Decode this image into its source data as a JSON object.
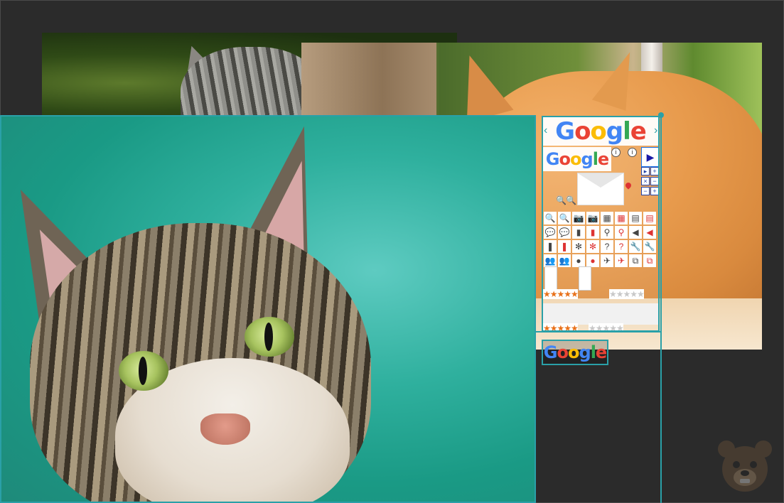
{
  "logo": {
    "letters": [
      "G",
      "o",
      "o",
      "g",
      "l",
      "e"
    ]
  },
  "sprite": {
    "chevron_left": "‹",
    "chevron_right": "›",
    "info_glyph": "i",
    "play_glyph": "▶",
    "tiny_buttons": [
      "▸",
      "+",
      "×",
      "−",
      "−",
      "+"
    ],
    "magnifier_glyphs": [
      "🔍",
      "🔍"
    ],
    "icon_grid": [
      {
        "glyph": "🔍",
        "red": false
      },
      {
        "glyph": "🔍",
        "red": true
      },
      {
        "glyph": "📷",
        "red": false
      },
      {
        "glyph": "📷",
        "red": true
      },
      {
        "glyph": "▦",
        "red": false
      },
      {
        "glyph": "▦",
        "red": true
      },
      {
        "glyph": "▤",
        "red": false
      },
      {
        "glyph": "▤",
        "red": true
      },
      {
        "glyph": "💬",
        "red": false
      },
      {
        "glyph": "💬",
        "red": true
      },
      {
        "glyph": "▮",
        "red": false
      },
      {
        "glyph": "▮",
        "red": true
      },
      {
        "glyph": "⚲",
        "red": false
      },
      {
        "glyph": "⚲",
        "red": true
      },
      {
        "glyph": "◀",
        "red": false
      },
      {
        "glyph": "◀",
        "red": true
      },
      {
        "glyph": "❚",
        "red": false
      },
      {
        "glyph": "❚",
        "red": true
      },
      {
        "glyph": "✻",
        "red": false
      },
      {
        "glyph": "✻",
        "red": true
      },
      {
        "glyph": "?",
        "red": false
      },
      {
        "glyph": "?",
        "red": true
      },
      {
        "glyph": "🔧",
        "red": false
      },
      {
        "glyph": "🔧",
        "red": true
      },
      {
        "glyph": "👥",
        "red": false
      },
      {
        "glyph": "👥",
        "red": true
      },
      {
        "glyph": "●",
        "red": false
      },
      {
        "glyph": "●",
        "red": true
      },
      {
        "glyph": "✈",
        "red": false
      },
      {
        "glyph": "✈",
        "red": true
      },
      {
        "glyph": "⧉",
        "red": false
      },
      {
        "glyph": "⧉",
        "red": true
      }
    ],
    "stars_orange_1": "★★★★★",
    "stars_gray_1": "★★★★★",
    "stars_orange_2": "★★★★★",
    "stars_gray_2": "★★★★★"
  },
  "colors": {
    "selection_border": "#2aa0a8",
    "canvas_bg": "#2b2b2b",
    "logo_blue": "#4285F4",
    "logo_red": "#EA4335",
    "logo_yellow": "#FBBC05",
    "logo_green": "#34A853"
  },
  "icons": {
    "watermark": "bear-icon"
  }
}
